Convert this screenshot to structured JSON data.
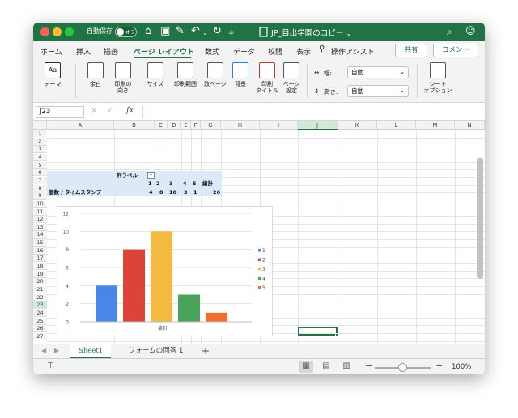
{
  "titlebar": {
    "autosave_label": "自動保存",
    "autosave_state": "オフ",
    "document_title": "JP_目出学園のコピー ⌄",
    "icons": [
      "home-icon",
      "save-icon",
      "edit-icon",
      "undo-icon",
      "redo-icon",
      "customize-icon",
      "search-icon",
      "person-icon"
    ]
  },
  "ribbon_tabs": [
    "ホーム",
    "挿入",
    "描画",
    "ページ レイアウト",
    "数式",
    "データ",
    "校閲",
    "表示"
  ],
  "active_tab": "ページ レイアウト",
  "tell_me": "操作アシスト",
  "share_label": "共有",
  "comment_label": "コメント",
  "ribbon": {
    "theme": "テーマ",
    "margins": "余白",
    "orientation_1": "印刷の",
    "orientation_2": "向き",
    "size": "サイズ",
    "print_area": "印刷範囲",
    "breaks": "改ページ",
    "background": "背景",
    "print_titles_1": "印刷",
    "print_titles_2": "タイトル",
    "page_setup_1": "ページ",
    "page_setup_2": "設定",
    "width_label": "幅:",
    "width_value": "自動",
    "height_label": "高さ:",
    "height_value": "自動",
    "sheet_options_1": "シート",
    "sheet_options_2": "オプション"
  },
  "formula_bar": {
    "name_box": "J23",
    "fx": "fx",
    "formula": ""
  },
  "columns": [
    "A",
    "B",
    "C",
    "D",
    "E",
    "F",
    "G",
    "H",
    "I",
    "J",
    "K",
    "L",
    "M",
    "N"
  ],
  "selected_column": "J",
  "rows": [
    "1",
    "2",
    "3",
    "4",
    "5",
    "6",
    "7",
    "8",
    "9",
    "10",
    "11",
    "12",
    "13",
    "14",
    "15",
    "16",
    "17",
    "18",
    "19",
    "20",
    "21",
    "22",
    "23",
    "24",
    "25",
    "26",
    "27"
  ],
  "selected_row": "23",
  "pivot": {
    "col_label": "列ラベル",
    "filter_icon": "dropdown-filter-icon",
    "headers": [
      "1",
      "2",
      "3",
      "4",
      "5",
      "総計"
    ],
    "row_label": "個数 / タイムスタンプ",
    "values": [
      "4",
      "8",
      "10",
      "3",
      "1",
      "26"
    ]
  },
  "chart_data": {
    "type": "bar",
    "categories": [
      "集計"
    ],
    "series": [
      {
        "name": "1",
        "values": [
          4
        ],
        "color": "#4a86e8"
      },
      {
        "name": "2",
        "values": [
          8
        ],
        "color": "#db4437"
      },
      {
        "name": "3",
        "values": [
          10
        ],
        "color": "#f4b942"
      },
      {
        "name": "4",
        "values": [
          3
        ],
        "color": "#4aa35a"
      },
      {
        "name": "5",
        "values": [
          1
        ],
        "color": "#f0702b"
      }
    ],
    "y_ticks": [
      "0",
      "2",
      "4",
      "6",
      "8",
      "10",
      "12"
    ],
    "ylim": [
      0,
      12
    ],
    "xlabel": "集計",
    "grid": true,
    "legend": "right"
  },
  "sheets": [
    "Sheet1",
    "フォームの回答 1"
  ],
  "active_sheet": "Sheet1",
  "zoom": "100%"
}
